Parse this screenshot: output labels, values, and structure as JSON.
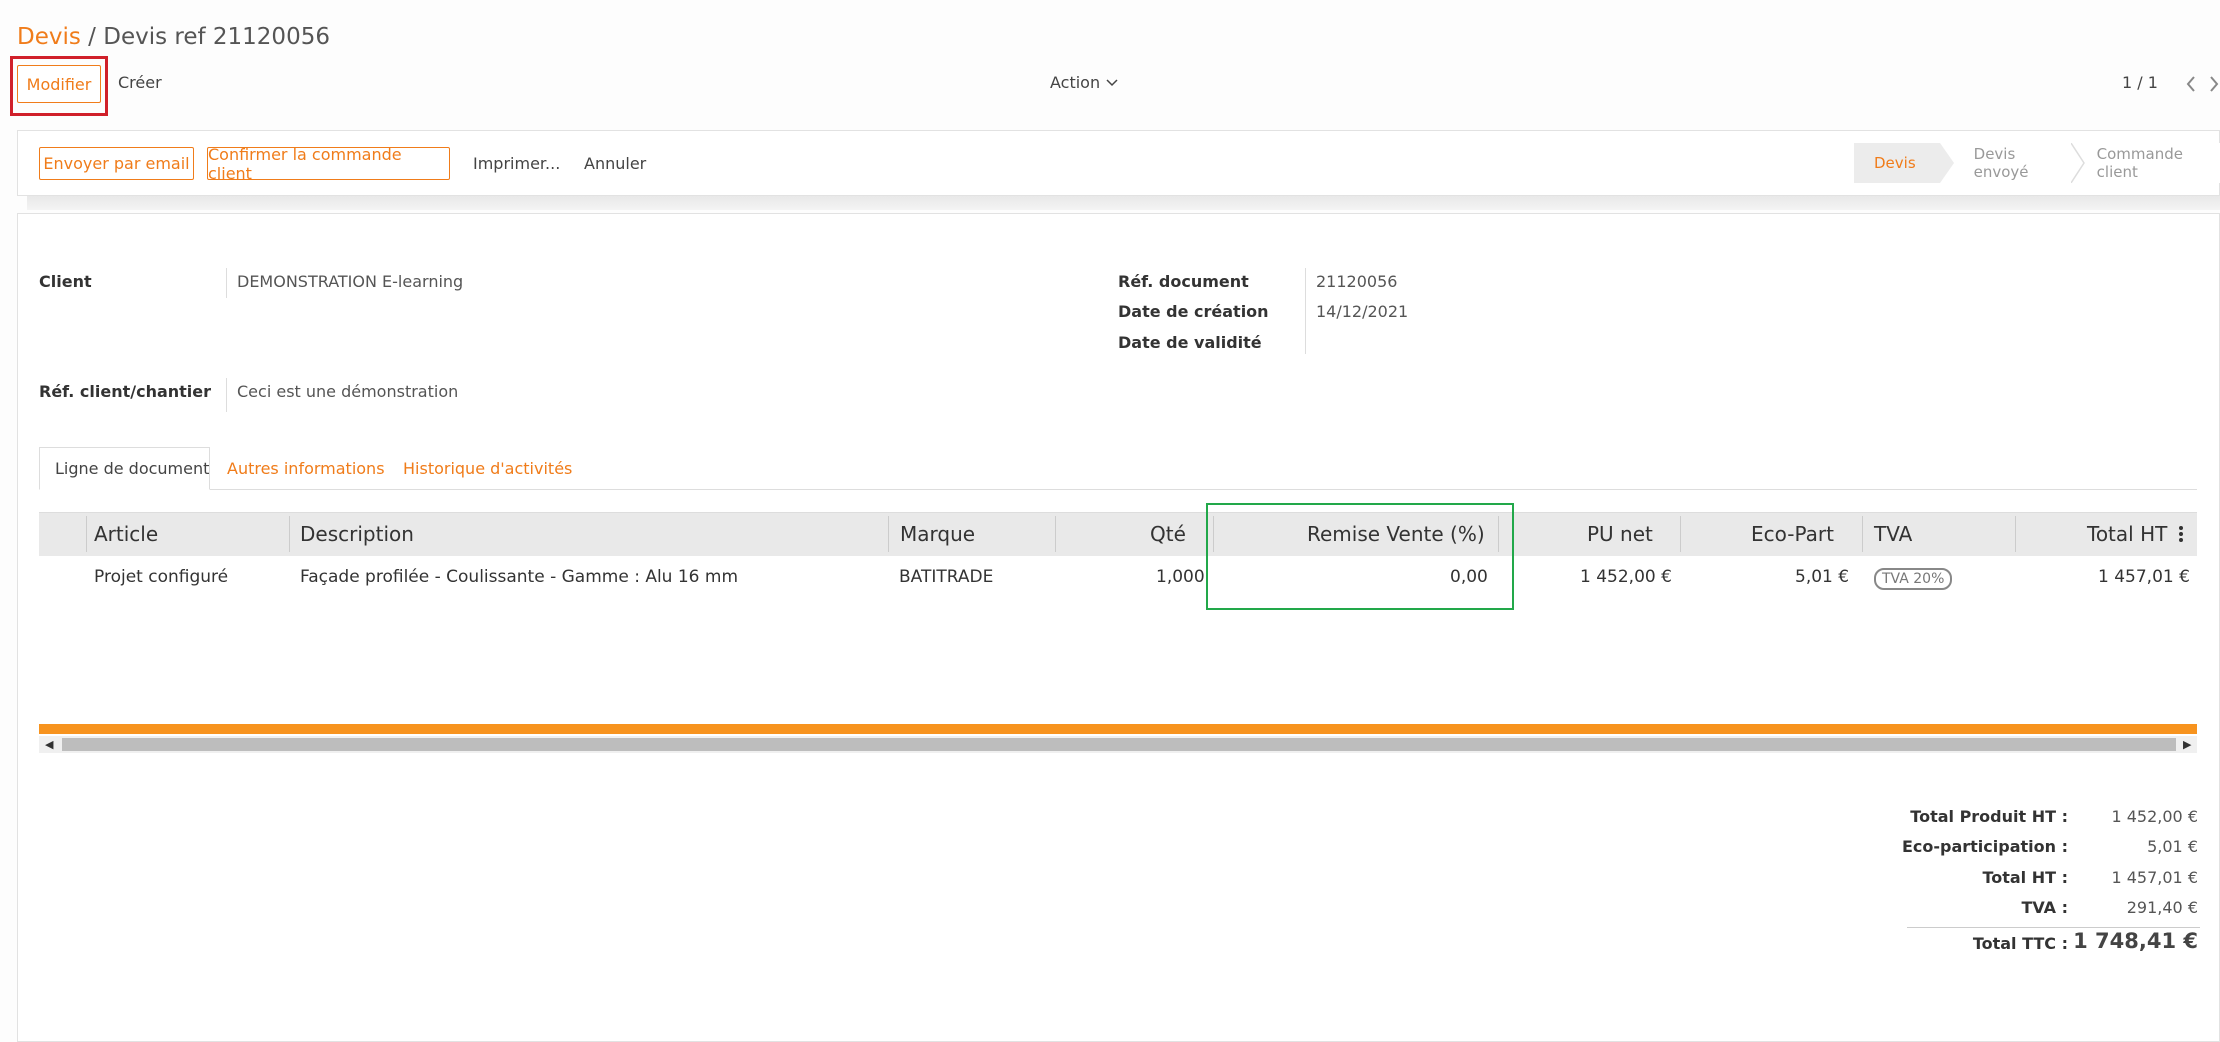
{
  "breadcrumb": {
    "parent": "Devis",
    "separator": " / ",
    "current": "Devis ref 21120056"
  },
  "toolbar": {
    "edit_label": "Modifier",
    "create_label": "Créer",
    "action_label": "Action",
    "pager": "1 / 1"
  },
  "actions": {
    "send_email": "Envoyer par email",
    "confirm_order": "Confirmer la commande client",
    "print": "Imprimer...",
    "cancel": "Annuler"
  },
  "statusbar": {
    "steps": [
      "Devis",
      "Devis envoyé",
      "Commande client"
    ],
    "active": "Devis"
  },
  "form": {
    "client_label": "Client",
    "client_value": "DEMONSTRATION E-learning",
    "ref_client_label": "Réf. client/chantier",
    "ref_client_value": "Ceci est une démonstration",
    "doc_ref_label": "Réf. document",
    "doc_ref_value": "21120056",
    "created_label": "Date de création",
    "created_value": "14/12/2021",
    "validity_label": "Date de validité",
    "validity_value": ""
  },
  "tabs": [
    "Ligne de document",
    "Autres informations",
    "Historique d'activités"
  ],
  "table": {
    "headers": [
      "Article",
      "Description",
      "Marque",
      "Qté",
      "Remise Vente (%)",
      "PU net",
      "Eco-Part",
      "TVA",
      "Total HT"
    ],
    "rows": [
      {
        "article": "Projet configuré",
        "description": "Façade profilée - Coulissante - Gamme : Alu 16 mm",
        "brand": "BATITRADE",
        "qty": "1,000",
        "discount": "0,00",
        "unit_price": "1 452,00 €",
        "eco": "5,01 €",
        "tva": "TVA 20%",
        "total": "1 457,01 €"
      }
    ]
  },
  "totals": {
    "product_ht_label": "Total Produit HT :",
    "product_ht": "1 452,00 €",
    "eco_label": "Eco-participation :",
    "eco": "5,01 €",
    "total_ht_label": "Total HT :",
    "total_ht": "1 457,01 €",
    "tva_label": "TVA :",
    "tva": "291,40 €",
    "ttc_label": "Total TTC :",
    "ttc": "1 748,41 €"
  },
  "colors": {
    "accent": "#f07c1a",
    "highlight_red": "#d0202a",
    "highlight_green": "#22a84a",
    "bar": "#f7931e"
  }
}
